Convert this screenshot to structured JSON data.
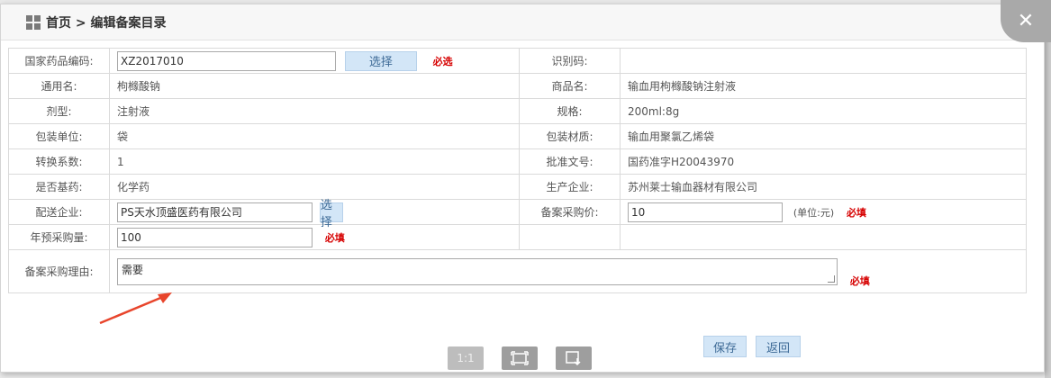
{
  "header": {
    "breadcrumb": "首页 > 编辑备案目录",
    "close_symbol": "✕"
  },
  "form": {
    "drug_code_label": "国家药品编码:",
    "drug_code_value": "XZ2017010",
    "select_button": "选择",
    "required_select": "必选",
    "id_code_label": "识别码:",
    "id_code_value": "",
    "generic_name_label": "通用名:",
    "generic_name_value": "枸橼酸钠",
    "trade_name_label": "商品名:",
    "trade_name_value": "输血用枸橼酸钠注射液",
    "dosage_form_label": "剂型:",
    "dosage_form_value": "注射液",
    "spec_label": "规格:",
    "spec_value": "200ml:8g",
    "pack_unit_label": "包装单位:",
    "pack_unit_value": "袋",
    "pack_material_label": "包装材质:",
    "pack_material_value": "输血用聚氯乙烯袋",
    "conversion_label": "转换系数:",
    "conversion_value": "1",
    "approval_label": "批准文号:",
    "approval_value": "国药准字H20043970",
    "essential_label": "是否基药:",
    "essential_value": "化学药",
    "manufacturer_label": "生产企业:",
    "manufacturer_value": "苏州莱士输血器材有限公司",
    "distributor_label": "配送企业:",
    "distributor_value": "PS天水顶盛医药有限公司",
    "distributor_select": "选择",
    "price_label": "备案采购价:",
    "price_value": "10",
    "price_unit": "(单位:元)",
    "required_fill": "必填",
    "annual_label": "年预采购量:",
    "annual_value": "100",
    "reason_label": "备案采购理由:",
    "reason_value": "需要"
  },
  "footer": {
    "save_button": "保存",
    "back_button": "返回",
    "tool_1to1": "1:1"
  }
}
